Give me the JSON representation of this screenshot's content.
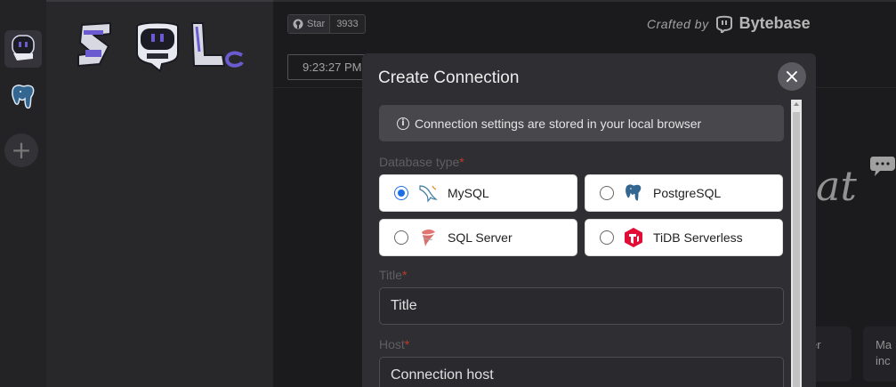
{
  "rail": {
    "items": [
      {
        "name": "sqlchat-bot-icon"
      },
      {
        "name": "postgresql-elephant-icon"
      }
    ],
    "add_label": "+"
  },
  "header": {
    "star_label": "Star",
    "star_count": "3933",
    "crafted_by": "Crafted by",
    "brand": "Bytebase",
    "time": "9:23:27 PM"
  },
  "background": {
    "chat_word": "at",
    "card1": "er",
    "card2_line1": "Ma",
    "card2_line2": "inc"
  },
  "modal": {
    "title": "Create Connection",
    "close": "×",
    "notice": "Connection settings are stored in your local browser",
    "db_type_label": "Database type",
    "required_mark": "*",
    "db_options": [
      {
        "label": "MySQL",
        "checked": true,
        "icon": "mysql-dolphin-icon"
      },
      {
        "label": "PostgreSQL",
        "checked": false,
        "icon": "postgresql-elephant-icon"
      },
      {
        "label": "SQL Server",
        "checked": false,
        "icon": "sqlserver-icon"
      },
      {
        "label": "TiDB Serverless",
        "checked": false,
        "icon": "tidb-icon"
      }
    ],
    "title_label": "Title",
    "title_placeholder": "Title",
    "host_label": "Host",
    "host_placeholder": "Connection host"
  },
  "colors": {
    "accent": "#1d6fe8",
    "required": "#c0392b",
    "tidb": "#e30c34"
  }
}
